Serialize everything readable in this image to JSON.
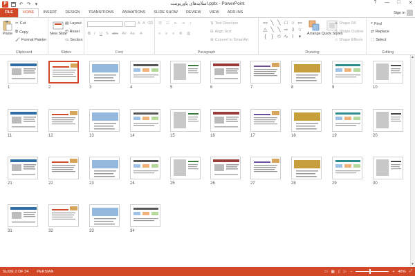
{
  "window": {
    "title": "اسلایدهای پاورپوینت.pptx - PowerPoint",
    "controls": [
      "?",
      "—",
      "□",
      "✕"
    ]
  },
  "qat": {
    "app_logo": "P",
    "save_icon": "save-icon",
    "undo_icon": "undo-icon",
    "redo_icon": "redo-icon"
  },
  "tabs": [
    {
      "label": "FILE"
    },
    {
      "label": "HOME"
    },
    {
      "label": "INSERT"
    },
    {
      "label": "DESIGN"
    },
    {
      "label": "TRANSITIONS"
    },
    {
      "label": "ANIMATIONS"
    },
    {
      "label": "SLIDE SHOW"
    },
    {
      "label": "REVIEW"
    },
    {
      "label": "VIEW"
    },
    {
      "label": "ADD-INS"
    }
  ],
  "account": {
    "signin": "Sign in"
  },
  "ribbon": {
    "clipboard": {
      "label": "Clipboard",
      "paste": "Paste",
      "cut": "Cut",
      "copy": "Copy",
      "format_painter": "Format Painter"
    },
    "slides": {
      "label": "Slides",
      "new_slide": "New Slide",
      "layout": "Layout",
      "reset": "Reset",
      "section": "Section"
    },
    "font": {
      "label": "Font"
    },
    "paragraph": {
      "label": "Paragraph",
      "text_direction": "Text Direction",
      "align_text": "Align Text",
      "convert_smartart": "Convert to SmartArt"
    },
    "drawing": {
      "label": "Drawing",
      "arrange": "Arrange",
      "quick_styles": "Quick Styles",
      "shape_fill": "Shape Fill",
      "shape_outline": "Shape Outline",
      "shape_effects": "Shape Effects"
    },
    "editing": {
      "label": "Editing",
      "find": "Find",
      "replace": "Replace",
      "select": "Select"
    }
  },
  "slides": [
    {
      "n": "1"
    },
    {
      "n": "2"
    },
    {
      "n": "3"
    },
    {
      "n": "4"
    },
    {
      "n": "5"
    },
    {
      "n": "6"
    },
    {
      "n": "7"
    },
    {
      "n": "8"
    },
    {
      "n": "9"
    },
    {
      "n": "10"
    },
    {
      "n": "11"
    },
    {
      "n": "12"
    },
    {
      "n": "13"
    },
    {
      "n": "14"
    },
    {
      "n": "15"
    },
    {
      "n": "16"
    },
    {
      "n": "17"
    },
    {
      "n": "18"
    },
    {
      "n": "19"
    },
    {
      "n": "20"
    },
    {
      "n": "21"
    },
    {
      "n": "22"
    },
    {
      "n": "23"
    },
    {
      "n": "24"
    },
    {
      "n": "25"
    },
    {
      "n": "26"
    },
    {
      "n": "27"
    },
    {
      "n": "28"
    },
    {
      "n": "29"
    },
    {
      "n": "30"
    },
    {
      "n": "31"
    },
    {
      "n": "32"
    },
    {
      "n": "33"
    },
    {
      "n": "34"
    }
  ],
  "selected_slide": "2",
  "status": {
    "slide_info": "SLIDE 2 OF 34",
    "language": "PERSIAN",
    "zoom": "48%"
  },
  "colors": {
    "accent": "#d24726"
  }
}
